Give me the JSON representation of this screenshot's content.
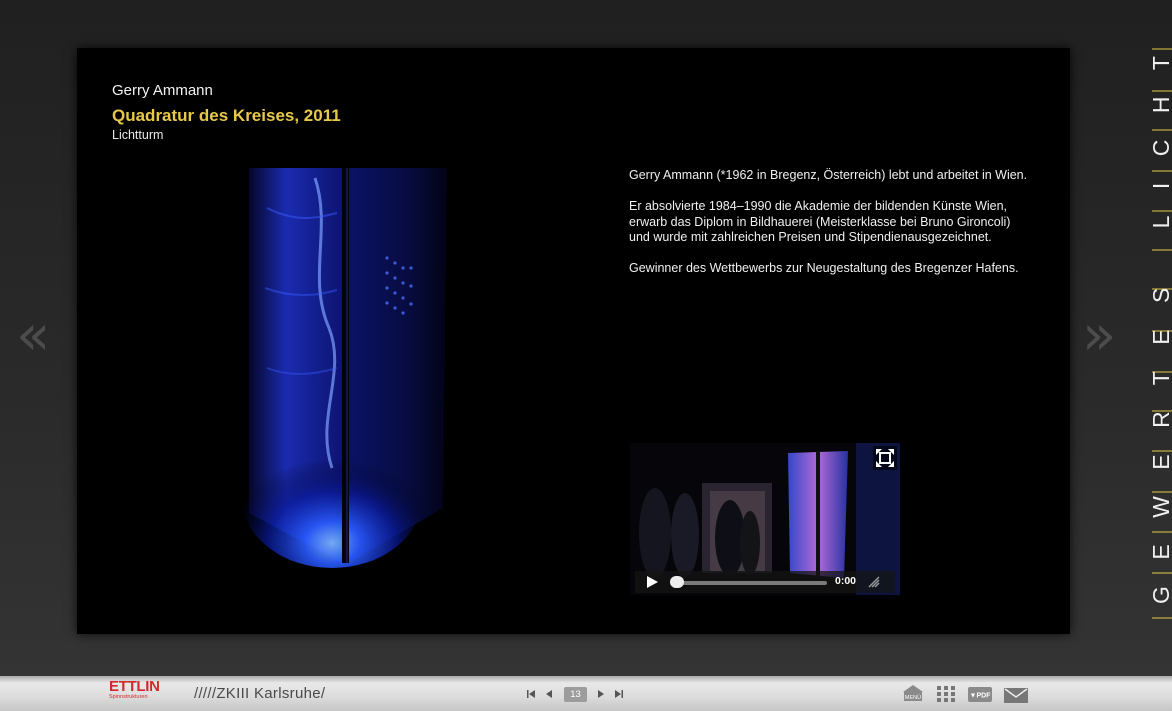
{
  "artwork": {
    "artist": "Gerry Ammann",
    "title": "Quadratur des Kreises, 2011",
    "subtitle": "Lichtturm"
  },
  "bio": [
    "Gerry Ammann (*1962 in Bregenz, Österreich) lebt und arbeitet in Wien.",
    "Er absolvierte 1984–1990 die Akademie der bildenden Künste Wien, erwarb das Diplom in Bildhauerei (Meisterklasse bei Bruno Gironcoli) und wurde mit zahlreichen Preisen und Stipendienausgezeichnet.",
    "Gewinner des Wettbewerbs zur Neugestaltung des Bregenzer Hafens."
  ],
  "video": {
    "time": "0:00",
    "progress": 0.02
  },
  "nav": {
    "prev": "«",
    "next": "»"
  },
  "side_title": "GEWERTES LICHT",
  "footer": {
    "ettlin_name": "ETTLIN",
    "ettlin_tag": "Spinnstrukturen",
    "zkm_text": "/////ZKIII Karlsruhe/",
    "page_number": "13",
    "icons": [
      "first-page-icon",
      "prev-page-icon",
      "next-page-icon",
      "last-page-icon",
      "menu-icon",
      "grid-icon",
      "pdf-icon",
      "mail-icon"
    ],
    "menu_label": "MENÜ",
    "pdf_label": "▼PDF"
  },
  "colors": {
    "accent_gold": "#e7c84b",
    "brand_red": "#d22a2a",
    "background": "#262626",
    "panel": "#000000"
  }
}
